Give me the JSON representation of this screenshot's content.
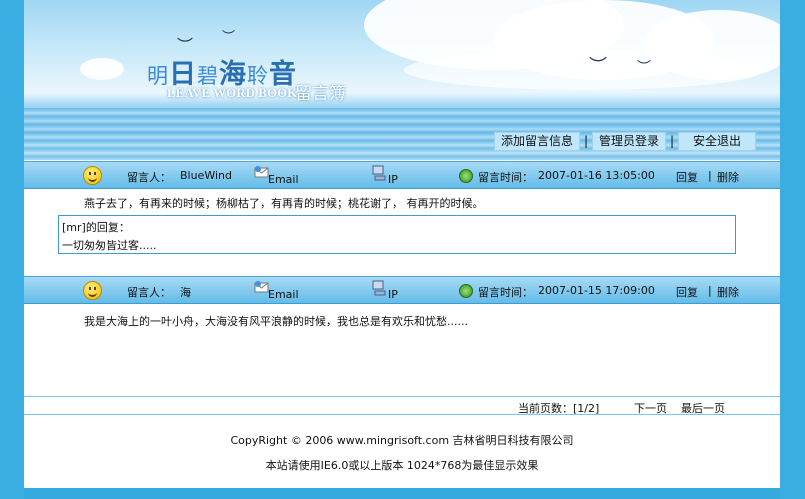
{
  "logo": {
    "title_part1": "明",
    "title_part2": "日",
    "title_part3": "碧",
    "title_part4": "海",
    "title_part5": "聆",
    "title_part6": "音",
    "english": "LEAVE WORD BOOK",
    "subtitle": "留言簿"
  },
  "nav": {
    "add": "添加留言信息",
    "admin": "管理员登录",
    "logout": "安全退出",
    "separator": "|"
  },
  "messages": [
    {
      "author_label": "留言人：",
      "author": "BlueWind",
      "email_label": "Email",
      "ip_label": "IP",
      "time_label": "留言时间：",
      "time": "2007-01-16 13:05:00",
      "reply_action": "回复",
      "separator": "|",
      "delete_action": "删除",
      "content": "燕子去了，有再来的时候；杨柳枯了，有再青的时候；桃花谢了， 有再开的时候。",
      "reply": {
        "header": "[mr]的回复：",
        "text": "一切匆匆皆过客....."
      }
    },
    {
      "author_label": "留言人：",
      "author": "海",
      "email_label": "Email",
      "ip_label": "IP",
      "time_label": "留言时间：",
      "time": "2007-01-15 17:09:00",
      "reply_action": "回复",
      "separator": "|",
      "delete_action": "删除",
      "content": "我是大海上的一叶小舟，大海没有风平浪静的时候，我也总是有欢乐和忧愁......"
    }
  ],
  "pager": {
    "current_label": "当前页数：[1/2]",
    "next": "下一页",
    "last": "最后一页"
  },
  "footer": {
    "copyright": "CopyRight © 2006 www.mingrisoft.com 吉林省明日科技有限公司",
    "note": "本站请使用IE6.0或以上版本 1024*768为最佳显示效果"
  },
  "colors": {
    "accent": "#35a9e0",
    "bar": "#63bce9",
    "border": "#3d9bd4"
  }
}
